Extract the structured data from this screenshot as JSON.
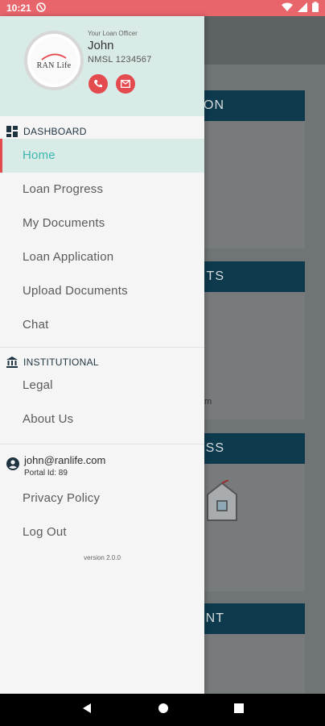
{
  "status_bar": {
    "time": "10:21"
  },
  "background": {
    "card_headings": [
      "ON",
      "TS",
      "SS",
      "ENT"
    ],
    "card_snippet_1": "m"
  },
  "drawer": {
    "officer": {
      "label": "Your Loan Officer",
      "name": "John",
      "nmls": "NMSL 1234567",
      "logo_text": "RAN Life"
    },
    "dashboard": {
      "heading": "DASHBOARD",
      "items": [
        "Home",
        "Loan Progress",
        "My Documents",
        "Loan Application",
        "Upload Documents",
        "Chat"
      ]
    },
    "institutional": {
      "heading": "INSTITUTIONAL",
      "items": [
        "Legal",
        "About Us"
      ]
    },
    "account": {
      "email": "john@ranlife.com",
      "portal": "Portal Id: 89",
      "items": [
        "Privacy Policy",
        "Log Out"
      ]
    },
    "version": "version 2.0.0"
  },
  "colors": {
    "accent": "#e44b4f",
    "teal": "#3cb7b0",
    "header_bg": "#d9ebe6",
    "status": "#e8666b"
  }
}
